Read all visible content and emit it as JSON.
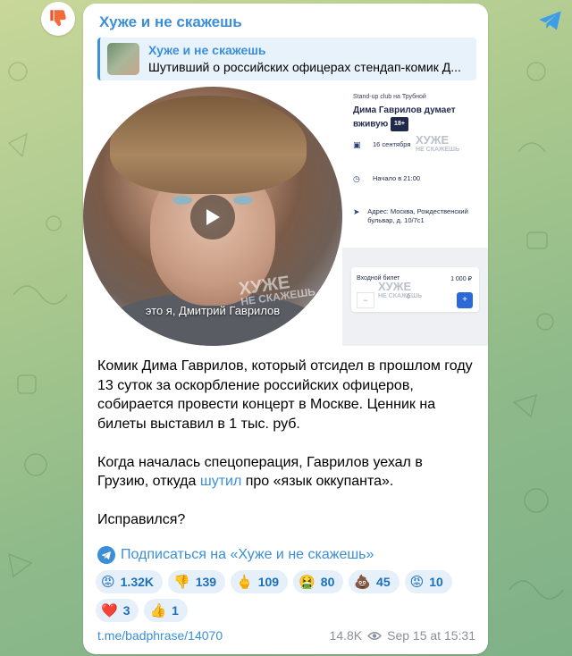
{
  "channel": {
    "name": "Хуже и не скажешь"
  },
  "reply": {
    "title": "Хуже и не скажешь",
    "text": "Шутивший о российских офицерах стендап-комик Д..."
  },
  "video": {
    "caption": "это я, Дмитрий Гаврилов",
    "watermark_top": "ХУЖЕ",
    "watermark_bottom": "НЕ СКАЖЕШЬ"
  },
  "poster": {
    "club": "Stand-up club на Трубной",
    "title": "Дима Гаврилов думает вживую",
    "age_badge": "18+",
    "date": "16 сентября",
    "time": "Начало в 21:00",
    "address": "Адрес: Москва, Рождественский бульвар, д. 10/7с1",
    "ticket_label": "Входной билет",
    "ticket_price": "1 000 ₽",
    "ticket_minus": "−",
    "ticket_count": "0",
    "ticket_plus": "+"
  },
  "post": {
    "paragraph1": "Комик Дима Гаврилов, который отсидел в прошлом году 13 суток за оскорбление российских офицеров, собирается провести концерт в Москве. Ценник на билеты выставил в 1 тыс. руб.",
    "paragraph2_before": "Когда началась спецоперация, Гаврилов уехал в Грузию, откуда ",
    "paragraph2_link": "шутил",
    "paragraph2_after": " про «язык оккупанта».",
    "paragraph3": "Исправился?"
  },
  "subscribe": {
    "label": "Подписаться на «Хуже и не скажешь»"
  },
  "reactions": [
    {
      "emoji": "😡",
      "count": "1.32K"
    },
    {
      "emoji": "👎",
      "count": "139"
    },
    {
      "emoji": "🖕",
      "count": "109"
    },
    {
      "emoji": "🤮",
      "count": "80"
    },
    {
      "emoji": "💩",
      "count": "45"
    },
    {
      "emoji": "😡",
      "count": "10"
    },
    {
      "emoji": "❤️",
      "count": "3"
    },
    {
      "emoji": "👍",
      "count": "1"
    }
  ],
  "footer": {
    "link": "t.me/badphrase/14070",
    "views": "14.8K",
    "timestamp": "Sep 15 at 15:31"
  },
  "colors": {
    "accent": "#3b8fd8",
    "reaction_bg": "#e6f0fa"
  },
  "icons": [
    "thumbs-down-avatar-icon",
    "telegram-plane-icon",
    "play-icon",
    "calendar-icon",
    "clock-icon",
    "location-icon",
    "eye-icon"
  ]
}
